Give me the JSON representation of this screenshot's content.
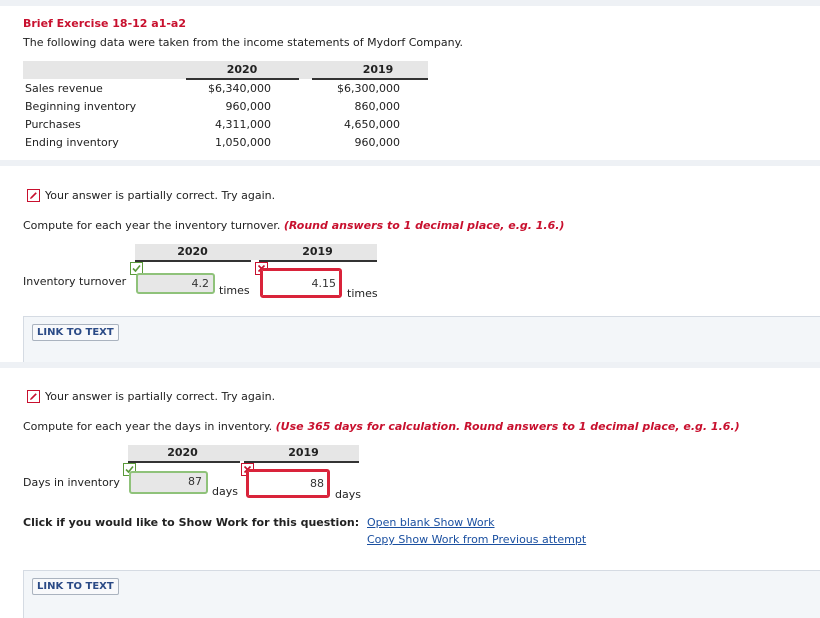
{
  "exercise": {
    "title": "Brief Exercise 18-12 a1-a2",
    "intro": "The following data were taken from the income statements of Mydorf Company."
  },
  "data_table": {
    "years": [
      "2020",
      "2019"
    ],
    "rows": [
      {
        "label": "Sales revenue",
        "values": [
          "$6,340,000",
          "$6,300,000"
        ]
      },
      {
        "label": "Beginning inventory",
        "values": [
          "960,000",
          "860,000"
        ]
      },
      {
        "label": "Purchases",
        "values": [
          "4,311,000",
          "4,650,000"
        ]
      },
      {
        "label": "Ending inventory",
        "values": [
          "1,050,000",
          "960,000"
        ]
      }
    ]
  },
  "part1": {
    "status": "Your answer is partially correct.  Try again.",
    "question": "Compute for each year the inventory turnover.",
    "hint": "(Round answers to 1 decimal place, e.g. 1.6.)",
    "years": [
      "2020",
      "2019"
    ],
    "row_label": "Inventory turnover",
    "answers": [
      {
        "value": "4.2",
        "correct": true
      },
      {
        "value": "4.15",
        "correct": false
      }
    ],
    "unit": "times",
    "link_label": "LINK TO TEXT"
  },
  "part2": {
    "status": "Your answer is partially correct.  Try again.",
    "question": "Compute for each year the days in inventory.",
    "hint": "(Use 365 days for calculation. Round answers to 1 decimal place, e.g. 1.6.)",
    "years": [
      "2020",
      "2019"
    ],
    "row_label": "Days in inventory",
    "answers": [
      {
        "value": "87",
        "correct": true
      },
      {
        "value": "88",
        "correct": false
      }
    ],
    "unit": "days",
    "link_label": "LINK TO TEXT"
  },
  "show_work": {
    "prompt": "Click if you would like to Show Work for this question:",
    "open_link": "Open blank Show Work",
    "copy_link": "Copy Show Work from Previous attempt"
  },
  "colors": {
    "accent_red": "#c8102e",
    "correct_green": "#8fc27a",
    "link_blue": "#1a4fa0"
  }
}
